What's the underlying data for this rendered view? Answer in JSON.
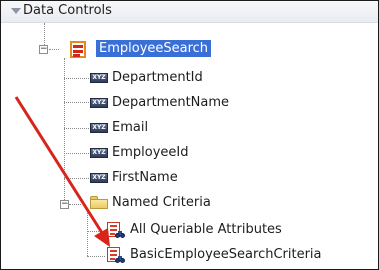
{
  "panel": {
    "title": "Data Controls"
  },
  "tree": {
    "root": {
      "label": "EmployeeSearch",
      "icon": "data-control-icon",
      "expanded": true,
      "selected": true
    },
    "attributes": [
      {
        "label": "DepartmentId",
        "icon": "attribute-xyz-icon"
      },
      {
        "label": "DepartmentName",
        "icon": "attribute-xyz-icon"
      },
      {
        "label": "Email",
        "icon": "attribute-xyz-icon"
      },
      {
        "label": "EmployeeId",
        "icon": "attribute-xyz-icon"
      },
      {
        "label": "FirstName",
        "icon": "attribute-xyz-icon"
      }
    ],
    "named_criteria": {
      "label": "Named Criteria",
      "icon": "folder-icon",
      "expanded": true,
      "items": [
        {
          "label": "All Queriable Attributes",
          "icon": "view-criteria-icon"
        },
        {
          "label": "BasicEmployeeSearchCriteria",
          "icon": "view-criteria-icon"
        }
      ]
    }
  },
  "icon_text": "XYZ",
  "colors": {
    "selection": "#3a6fd8",
    "annotation_arrow": "#d8251b"
  }
}
